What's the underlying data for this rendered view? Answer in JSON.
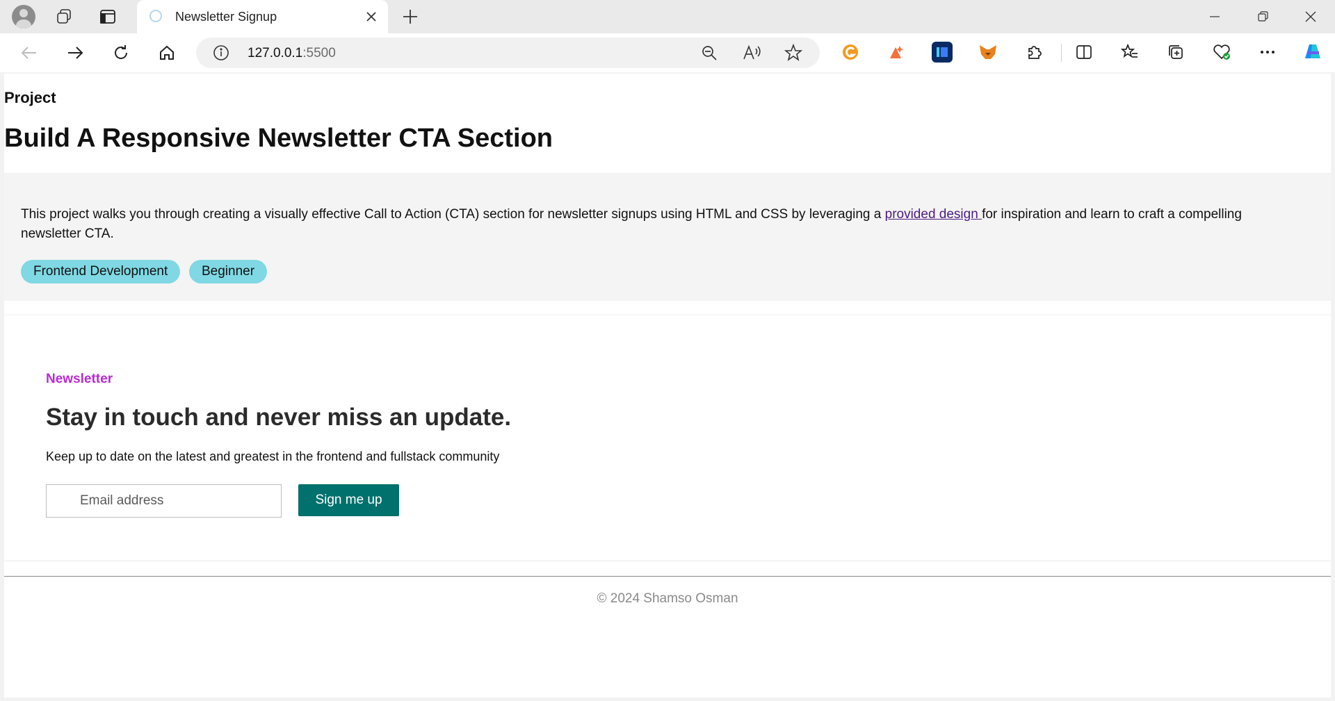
{
  "browser": {
    "tab_title": "Newsletter Signup",
    "address_host": "127.0.0.1",
    "address_port": ":5500"
  },
  "project": {
    "label": "Project",
    "title": "Build A Responsive Newsletter CTA Section",
    "description_before": "This project walks you through creating a visually effective Call to Action (CTA) section for newsletter signups using HTML and CSS by leveraging a ",
    "description_link": "provided design ",
    "description_after": "for inspiration and learn to craft a compelling newsletter CTA.",
    "tags": [
      "Frontend Development",
      "Beginner"
    ]
  },
  "cta": {
    "eyebrow": "Newsletter",
    "heading": "Stay in touch and never miss an update.",
    "subtext": "Keep up to date on the latest and greatest in the frontend and fullstack community",
    "email_placeholder": "Email address",
    "button_label": "Sign me up"
  },
  "footer": {
    "text": "© 2024 Shamso Osman"
  },
  "colors": {
    "accent_magenta": "#b92ad2",
    "button_teal": "#00716d",
    "tag_cyan": "#7fd8e3"
  }
}
